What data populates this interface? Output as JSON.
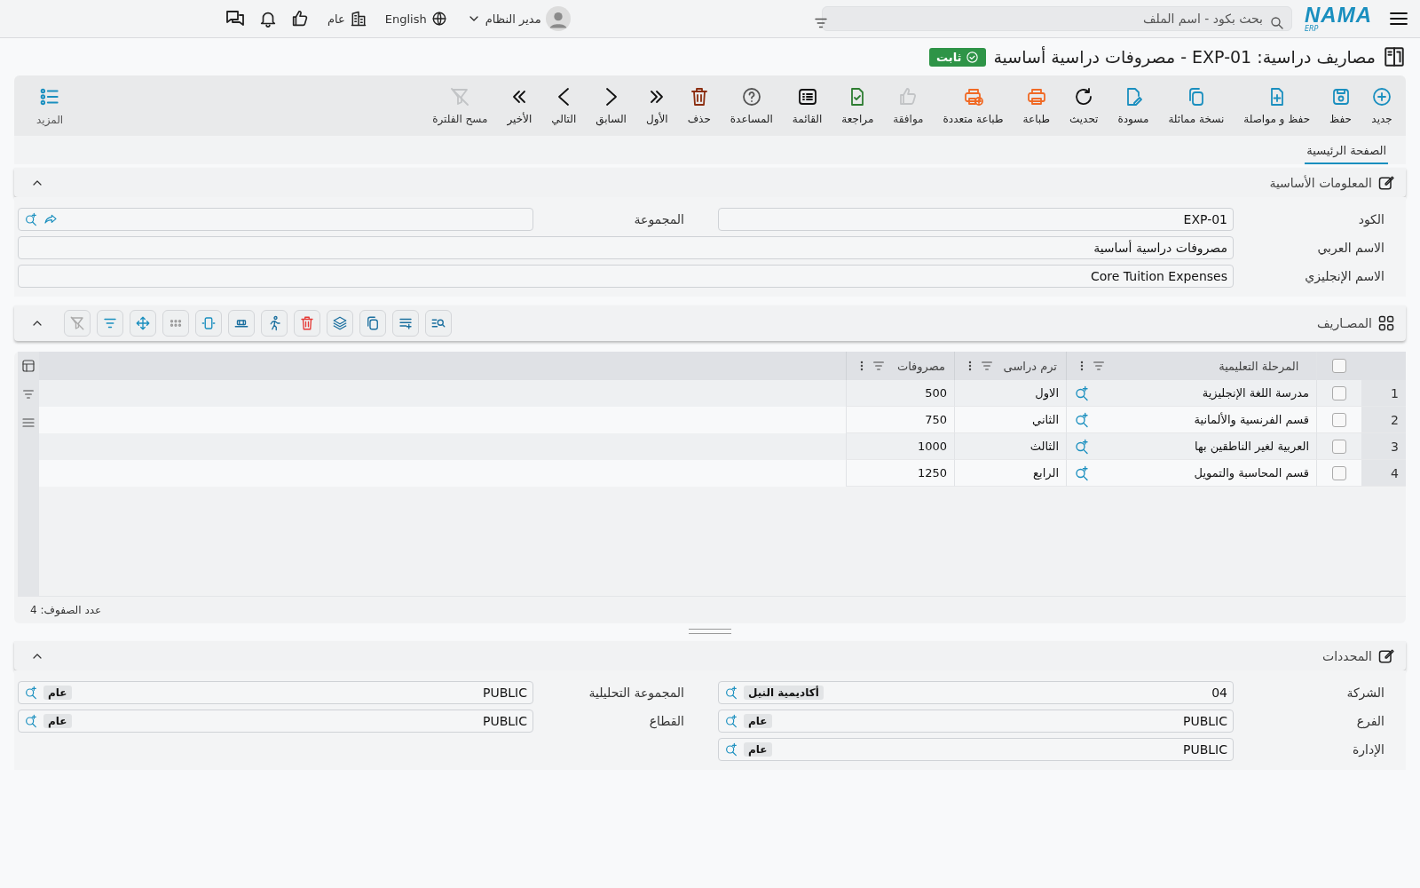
{
  "topbar": {
    "logo": "NAMA",
    "logo_sub": "ERP",
    "search": {
      "placeholder": "بحث بكود - اسم الملف"
    },
    "company": "عام",
    "language": "English",
    "user": "مدير النظام"
  },
  "title": {
    "text": "مصاريف دراسية: EXP-01 - مصروفات دراسية أساسية",
    "status": "ثابت"
  },
  "toolbar": [
    {
      "label": "جديد",
      "disabled": false
    },
    {
      "label": "حفظ",
      "disabled": false
    },
    {
      "label": "حفظ و مواصلة",
      "disabled": false
    },
    {
      "label": "نسخة مماثلة",
      "disabled": false
    },
    {
      "label": "مسودة",
      "disabled": false
    },
    {
      "label": "تحديث",
      "disabled": false
    },
    {
      "label": "طباعة",
      "disabled": false
    },
    {
      "label": "طباعة متعددة",
      "disabled": false
    },
    {
      "label": "موافقة",
      "disabled": true
    },
    {
      "label": "مراجعة",
      "disabled": false
    },
    {
      "label": "القائمة",
      "disabled": false
    },
    {
      "label": "المساعدة",
      "disabled": false
    },
    {
      "label": "حذف",
      "disabled": false
    },
    {
      "label": "الأول",
      "disabled": false
    },
    {
      "label": "السابق",
      "disabled": false
    },
    {
      "label": "التالي",
      "disabled": false
    },
    {
      "label": "الأخير",
      "disabled": false
    },
    {
      "label": "مسح الفلترة",
      "disabled": true
    }
  ],
  "more": "المزيد",
  "tabs": [
    {
      "label": "الصفحة الرئيسية",
      "selected": true
    }
  ],
  "basic": {
    "title": "المعلومات الأساسية",
    "expanded": true,
    "fields": [
      {
        "kind": "half",
        "label": "الكود",
        "value": "EXP-01"
      },
      {
        "kind": "group",
        "label": "المجموعة"
      },
      {
        "kind": "wide",
        "label": "الاسم العربي",
        "value": "مصروفات دراسية أساسية"
      },
      {
        "kind": "wide",
        "label": "الاسم الإنجليزي",
        "value": "Core Tuition Expenses"
      }
    ]
  },
  "grid": {
    "title": "المصـاريف",
    "expanded": true,
    "all_checked": false,
    "columns": [
      "المرحلة التعليمية",
      "ترم دراسى",
      "مصروفات"
    ],
    "rows": [
      {
        "number": "1",
        "checked": false,
        "cells": [
          "مدرسة اللغة الإنجليزية",
          "الاول",
          "500"
        ]
      },
      {
        "number": "2",
        "checked": false,
        "cells": [
          "قسم الفرنسية والألمانية",
          "الثاني",
          "750"
        ]
      },
      {
        "number": "3",
        "checked": false,
        "cells": [
          "العربية لغير الناطقين بها",
          "الثالث",
          "1000"
        ]
      },
      {
        "number": "4",
        "checked": false,
        "cells": [
          "قسم المحاسبة والتمويل",
          "الرابع",
          "1250"
        ]
      }
    ],
    "footer": "عدد الصفوف: 4"
  },
  "limits": {
    "title": "المحددات",
    "expanded": true,
    "fields": [
      {
        "kind": "tagged",
        "label": "الشركة",
        "value": "04",
        "tag": "أكاديمية النيل"
      },
      {
        "kind": "tagged",
        "label": "المجموعة التحليلية",
        "value": "PUBLIC",
        "tag": "عام"
      },
      {
        "kind": "tagged",
        "label": "الفرع",
        "value": "PUBLIC",
        "tag": "عام"
      },
      {
        "kind": "tagged",
        "label": "القطاع",
        "value": "PUBLIC",
        "tag": "عام"
      },
      {
        "kind": "tagged",
        "label": "الإدارة",
        "value": "PUBLIC",
        "tag": "عام"
      }
    ]
  }
}
